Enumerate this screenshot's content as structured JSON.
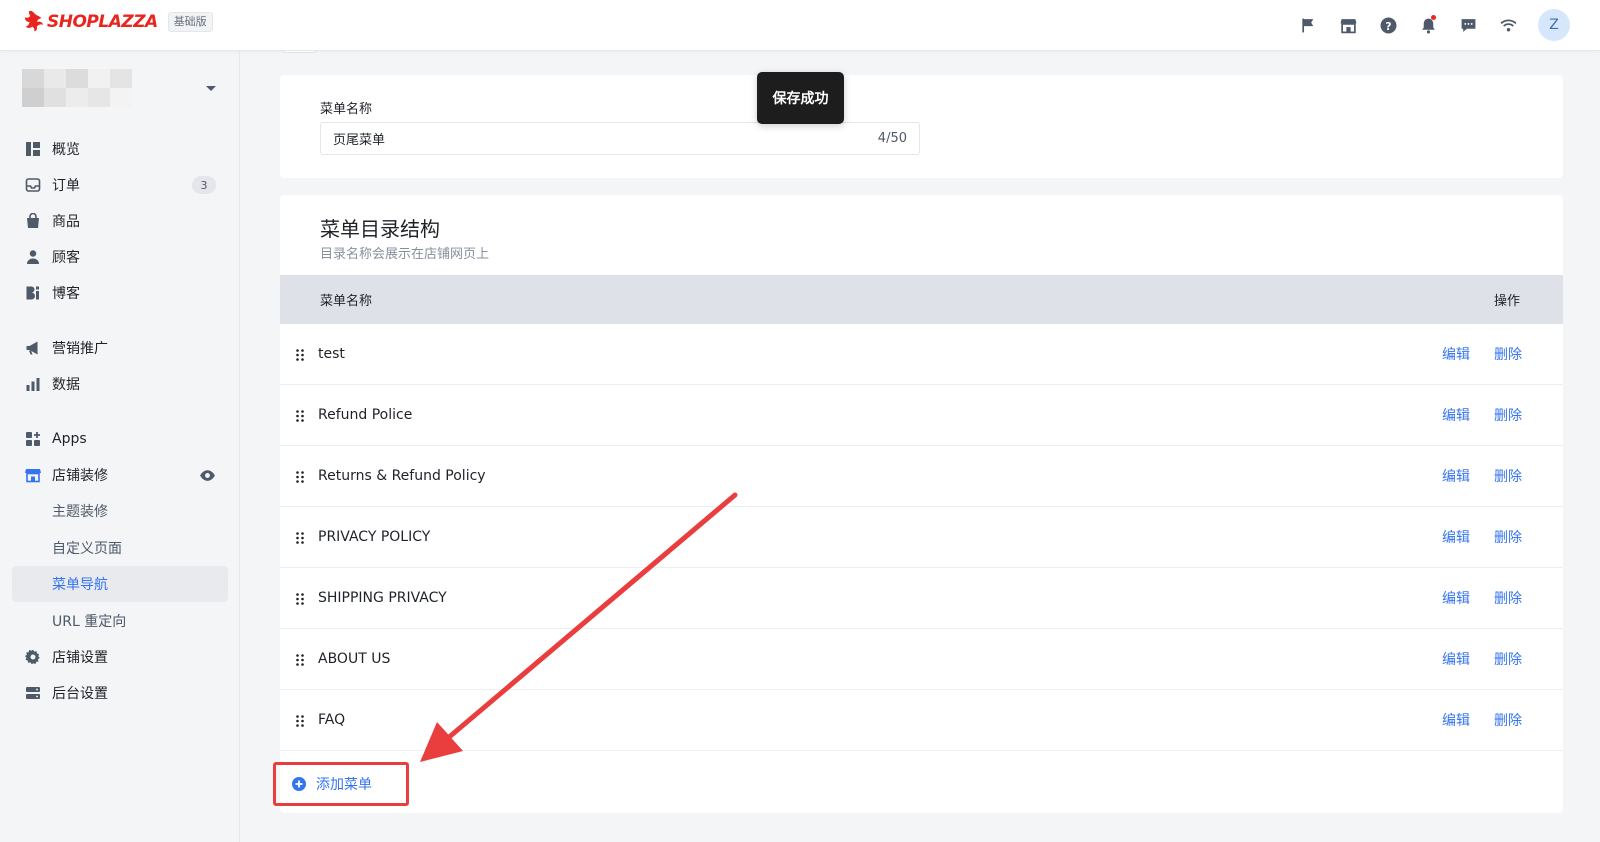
{
  "topbar": {
    "brand": "SHOPLAZZA",
    "plan_badge": "基础版",
    "icons": [
      "flag-icon",
      "store-icon",
      "help-icon",
      "bell-icon",
      "message-icon",
      "wifi-icon"
    ],
    "avatar_letter": "Z"
  },
  "sidebar": {
    "items": [
      {
        "label": "概览",
        "icon": "dashboard-icon"
      },
      {
        "label": "订单",
        "icon": "inbox-icon",
        "badge": "3"
      },
      {
        "label": "商品",
        "icon": "bag-icon"
      },
      {
        "label": "顾客",
        "icon": "person-icon"
      },
      {
        "label": "博客",
        "icon": "blog-icon"
      },
      {
        "label": "营销推广",
        "icon": "megaphone-icon"
      },
      {
        "label": "数据",
        "icon": "bar-chart-icon"
      },
      {
        "label": "Apps",
        "icon": "apps-icon"
      },
      {
        "label": "店铺装修",
        "icon": "storefront-icon"
      },
      {
        "label": "主题装修"
      },
      {
        "label": "自定义页面"
      },
      {
        "label": "菜单导航",
        "active": true
      },
      {
        "label": "URL 重定向"
      },
      {
        "label": "店铺设置",
        "icon": "gear-icon"
      },
      {
        "label": "后台设置",
        "icon": "server-icon"
      }
    ]
  },
  "toast": {
    "text": "保存成功"
  },
  "menu_name": {
    "label": "菜单名称",
    "value": "页尾菜单",
    "counter": "4/50"
  },
  "structure": {
    "title": "菜单目录结构",
    "subtitle": "目录名称会展示在店铺网页上",
    "col_name": "菜单名称",
    "col_ops": "操作",
    "edit_label": "编辑",
    "delete_label": "删除",
    "rows": [
      {
        "name": "test"
      },
      {
        "name": "Refund Police"
      },
      {
        "name": "Returns & Refund Policy"
      },
      {
        "name": "PRIVACY POLICY"
      },
      {
        "name": "SHIPPING PRIVACY"
      },
      {
        "name": "ABOUT US"
      },
      {
        "name": "FAQ"
      }
    ],
    "add_label": "添加菜单"
  },
  "colors": {
    "accent": "#3574f0",
    "brand": "#e8251f",
    "annotation": "#ea3e3e"
  }
}
